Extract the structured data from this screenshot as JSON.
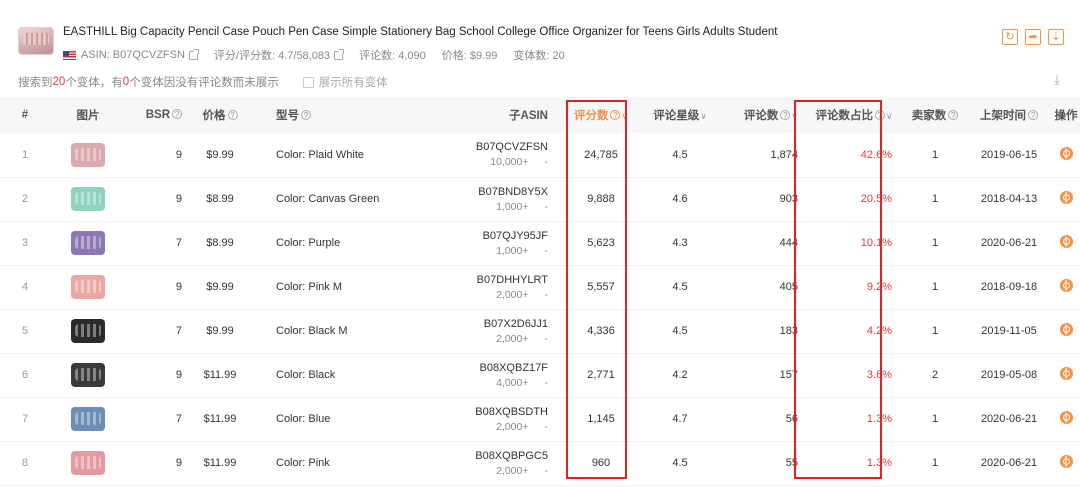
{
  "product": {
    "title": "EASTHILL Big Capacity Pencil Case Pouch Pen Case Simple Stationery Bag School College Office Organizer for Teens Girls Adults Student",
    "asin_label": "ASIN: B07QCVZFSN",
    "rating_label": "评分/评分数: 4.7/58,083",
    "reviews_label": "评论数: 4,090",
    "price_label": "价格: $9.99",
    "variants_label": "变体数: 20"
  },
  "summary": {
    "prefix": "搜索到",
    "variant_count": "20",
    "mid": "个变体，有",
    "no_review_count": "0",
    "suffix": "个变体因没有评论数而未展示",
    "show_all_label": "展示所有变体"
  },
  "icons": {
    "refresh": "refresh-icon",
    "share": "share-icon",
    "download": "download-icon",
    "operation": "operation-icon"
  },
  "accent_color": "#f19148",
  "highlight_color": "#e4211c",
  "table": {
    "headers": {
      "index": "#",
      "image": "图片",
      "bsr": "BSR",
      "price": "价格",
      "model": "型号",
      "child_asin": "子ASIN",
      "ratings": "评分数",
      "star": "评论星级",
      "reviews": "评论数",
      "review_share": "评论数占比",
      "sellers": "卖家数",
      "listed": "上架时间",
      "action": "操作"
    },
    "rows": [
      {
        "idx": "1",
        "bsr": "9",
        "price": "$9.99",
        "model": "Color: Plaid White",
        "asin": "B07QCVZFSN",
        "sales": "10,000+",
        "sales_dash": "-",
        "ratings": "24,785",
        "star": "4.5",
        "reviews": "1,874",
        "share": "42.6%",
        "sellers": "1",
        "date": "2019-06-15",
        "img_color": "#d9a9ad"
      },
      {
        "idx": "2",
        "bsr": "9",
        "price": "$8.99",
        "model": "Color: Canvas Green",
        "asin": "B07BND8Y5X",
        "sales": "1,000+",
        "sales_dash": "-",
        "ratings": "9,888",
        "star": "4.6",
        "reviews": "903",
        "share": "20.5%",
        "sellers": "1",
        "date": "2018-04-13",
        "img_color": "#8fd2bf"
      },
      {
        "idx": "3",
        "bsr": "7",
        "price": "$8.99",
        "model": "Color: Purple",
        "asin": "B07QJY95JF",
        "sales": "1,000+",
        "sales_dash": "-",
        "ratings": "5,623",
        "star": "4.3",
        "reviews": "444",
        "share": "10.1%",
        "sellers": "1",
        "date": "2020-06-21",
        "img_color": "#8c78b4"
      },
      {
        "idx": "4",
        "bsr": "9",
        "price": "$9.99",
        "model": "Color: Pink M",
        "asin": "B07DHHYLRT",
        "sales": "2,000+",
        "sales_dash": "-",
        "ratings": "5,557",
        "star": "4.5",
        "reviews": "405",
        "share": "9.2%",
        "sellers": "1",
        "date": "2018-09-18",
        "img_color": "#eaa7a4"
      },
      {
        "idx": "5",
        "bsr": "7",
        "price": "$9.99",
        "model": "Color: Black M",
        "asin": "B07X2D6JJ1",
        "sales": "2,000+",
        "sales_dash": "-",
        "ratings": "4,336",
        "star": "4.5",
        "reviews": "183",
        "share": "4.2%",
        "sellers": "1",
        "date": "2019-11-05",
        "img_color": "#2b2b2b"
      },
      {
        "idx": "6",
        "bsr": "9",
        "price": "$11.99",
        "model": "Color: Black",
        "asin": "B08XQBZ17F",
        "sales": "4,000+",
        "sales_dash": "-",
        "ratings": "2,771",
        "star": "4.2",
        "reviews": "157",
        "share": "3.6%",
        "sellers": "2",
        "date": "2019-05-08",
        "img_color": "#3a3a3a"
      },
      {
        "idx": "7",
        "bsr": "7",
        "price": "$11.99",
        "model": "Color: Blue",
        "asin": "B08XQBSDTH",
        "sales": "2,000+",
        "sales_dash": "-",
        "ratings": "1,145",
        "star": "4.7",
        "reviews": "56",
        "share": "1.3%",
        "sellers": "1",
        "date": "2020-06-21",
        "img_color": "#6b8db6"
      },
      {
        "idx": "8",
        "bsr": "9",
        "price": "$11.99",
        "model": "Color: Pink",
        "asin": "B08XQBPGC5",
        "sales": "2,000+",
        "sales_dash": "-",
        "ratings": "960",
        "star": "4.5",
        "reviews": "55",
        "share": "1.3%",
        "sellers": "1",
        "date": "2020-06-21",
        "img_color": "#e29aa0"
      }
    ]
  }
}
